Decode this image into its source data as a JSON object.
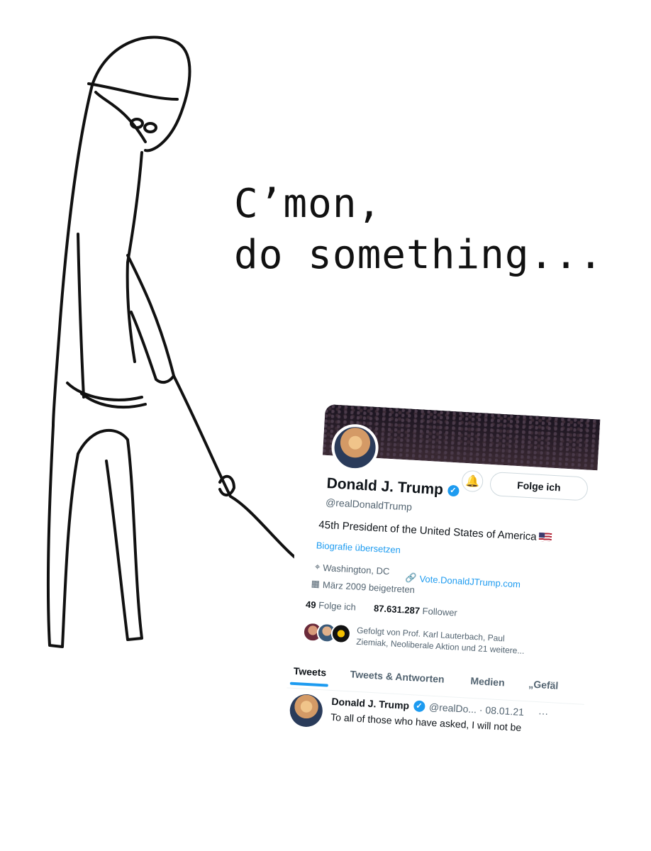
{
  "caption": {
    "line1": "C’mon,",
    "line2": "do something..."
  },
  "profile": {
    "name": "Donald J. Trump",
    "handle": "@realDonaldTrump",
    "bio": "45th President of the United States of America",
    "translate_label": "Biografie übersetzen",
    "location": "Washington, DC",
    "website": "Vote.DonaldJTrump.com",
    "joined": "März 2009 beigetreten",
    "following_count": "49",
    "following_label": "Folge ich",
    "followers_count": "87.631.287",
    "followers_label": "Follower",
    "followed_by": "Gefolgt von Prof. Karl Lauterbach, Paul Ziemiak, Neoliberale Aktion und 21 weitere...",
    "follow_button": "Folge ich"
  },
  "tabs": [
    "Tweets",
    "Tweets & Antworten",
    "Medien",
    "„Gefäl"
  ],
  "tweet": {
    "name": "Donald J. Trump",
    "handle_date": "@realDo... · 08.01.21",
    "more": "···",
    "text": "To all of those who have asked, I will not be"
  },
  "icons": {
    "verified": "verified-badge-icon",
    "bell": "notification-bell-icon",
    "location": "location-pin-icon",
    "link": "link-icon",
    "calendar": "calendar-icon"
  },
  "colors": {
    "accent": "#1d9bf0",
    "text": "#0f1419",
    "muted": "#536471"
  }
}
